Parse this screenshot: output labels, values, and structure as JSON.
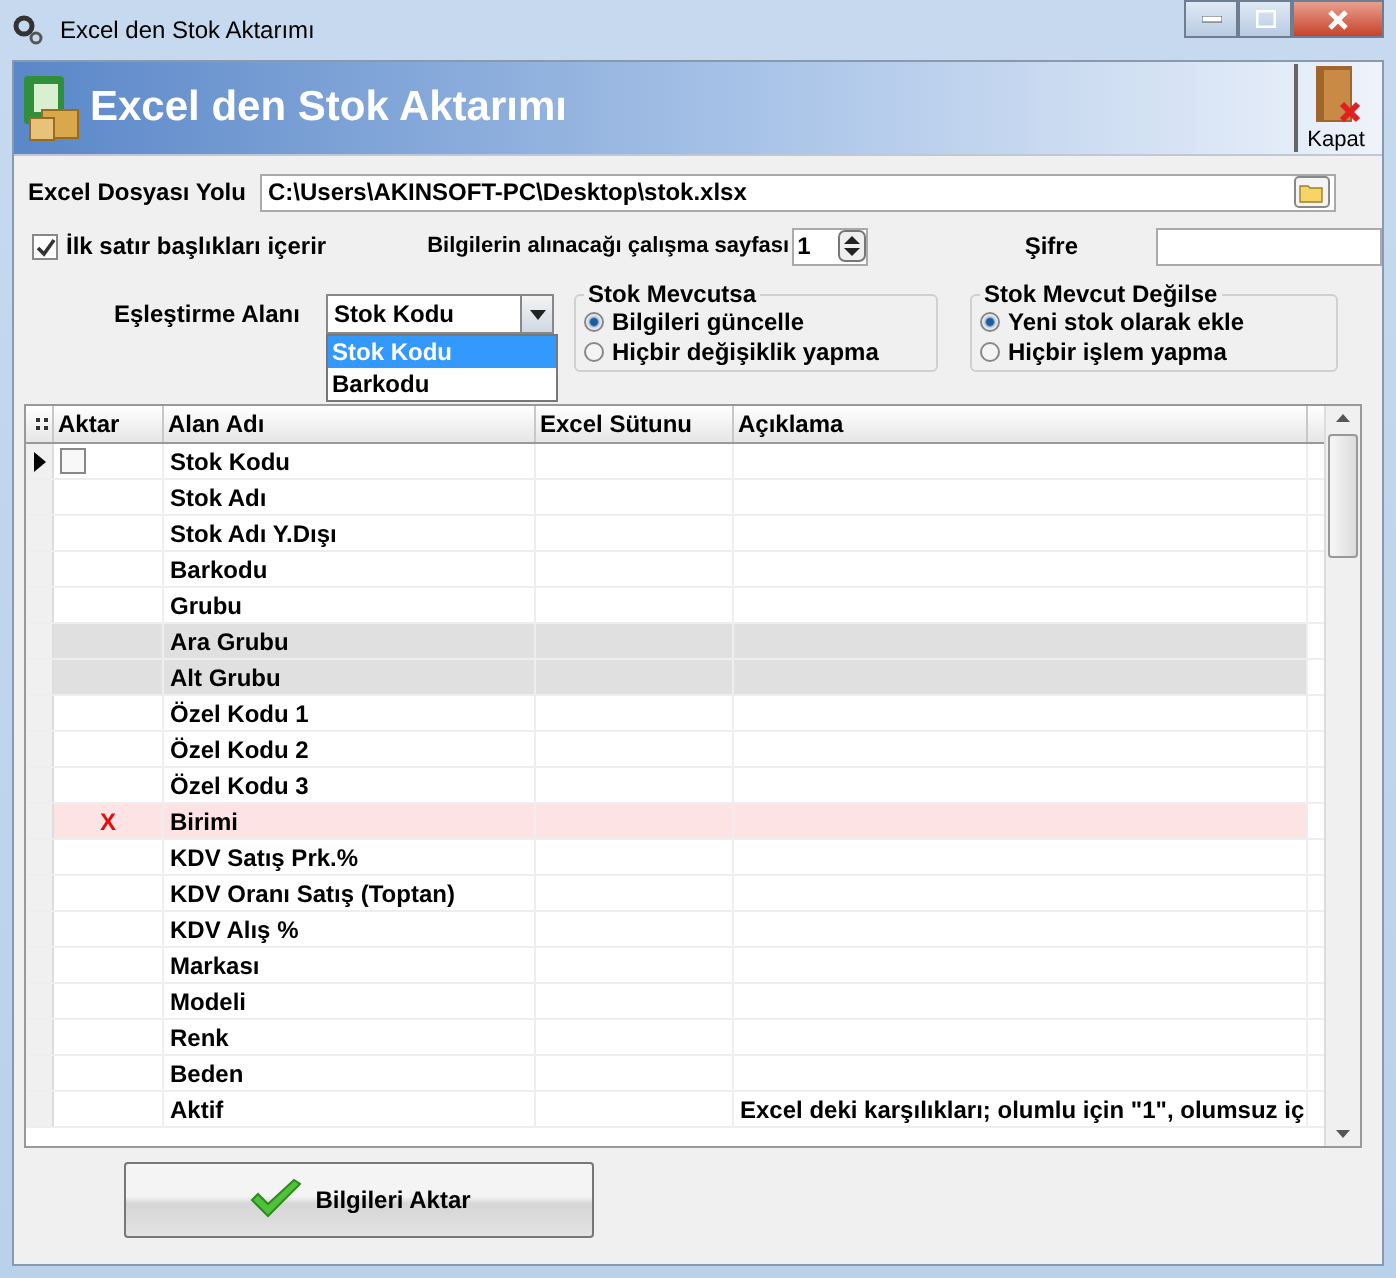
{
  "window": {
    "title": "Excel den Stok Aktarımı"
  },
  "header": {
    "title": "Excel den Stok Aktarımı",
    "close_button": "Kapat"
  },
  "file_path": {
    "label": "Excel Dosyası Yolu",
    "value": "C:\\Users\\AKINSOFT-PC\\Desktop\\stok.xlsx"
  },
  "first_row_headers": {
    "label": "İlk satır başlıkları içerir",
    "checked": true
  },
  "sheet": {
    "label": "Bilgilerin alınacağı çalışma sayfası",
    "value": "1"
  },
  "password": {
    "label": "Şifre"
  },
  "match_field": {
    "label": "Eşleştirme Alanı",
    "value": "Stok Kodu",
    "options": [
      {
        "label": "Stok Kodu",
        "selected": true
      },
      {
        "label": "Barkodu",
        "selected": false
      }
    ]
  },
  "groups": [
    {
      "title": "Stok Mevcutsa",
      "options": [
        {
          "label": "Bilgileri güncelle",
          "selected": true
        },
        {
          "label": "Hiçbir değişiklik yapma",
          "selected": false
        }
      ]
    },
    {
      "title": "Stok Mevcut Değilse",
      "options": [
        {
          "label": "Yeni stok olarak ekle",
          "selected": true
        },
        {
          "label": "Hiçbir işlem yapma",
          "selected": false
        }
      ]
    }
  ],
  "grid": {
    "columns": [
      "Aktar",
      "Alan Adı",
      "Excel Sütunu",
      "Açıklama"
    ],
    "rows": [
      {
        "kind": "normal",
        "current": true,
        "checked": false,
        "field": "Stok Kodu"
      },
      {
        "kind": "normal",
        "current": false,
        "field": "Stok Adı"
      },
      {
        "kind": "normal",
        "current": false,
        "field": "Stok Adı Y.Dışı"
      },
      {
        "kind": "normal",
        "current": false,
        "field": "Barkodu"
      },
      {
        "kind": "normal",
        "current": false,
        "field": "Grubu"
      },
      {
        "kind": "disabled",
        "current": false,
        "field": "Ara Grubu"
      },
      {
        "kind": "disabled",
        "current": false,
        "field": "Alt Grubu"
      },
      {
        "kind": "normal",
        "current": false,
        "field": "Özel Kodu 1"
      },
      {
        "kind": "normal",
        "current": false,
        "field": "Özel Kodu 2"
      },
      {
        "kind": "normal",
        "current": false,
        "field": "Özel Kodu 3"
      },
      {
        "kind": "required",
        "current": false,
        "mark": "X",
        "field": "Birimi"
      },
      {
        "kind": "normal",
        "current": false,
        "field": "KDV Satış Prk.%"
      },
      {
        "kind": "normal",
        "current": false,
        "field": "KDV Oranı Satış (Toptan)"
      },
      {
        "kind": "normal",
        "current": false,
        "field": "KDV Alış %"
      },
      {
        "kind": "normal",
        "current": false,
        "field": "Markası"
      },
      {
        "kind": "normal",
        "current": false,
        "field": "Modeli"
      },
      {
        "kind": "normal",
        "current": false,
        "field": "Renk"
      },
      {
        "kind": "normal",
        "current": false,
        "field": "Beden"
      },
      {
        "kind": "normal",
        "current": false,
        "field": "Aktif",
        "note": "Excel deki karşılıkları; olumlu için \"1\", olumsuz iç"
      }
    ]
  },
  "submit_button": "Bilgileri Aktar"
}
